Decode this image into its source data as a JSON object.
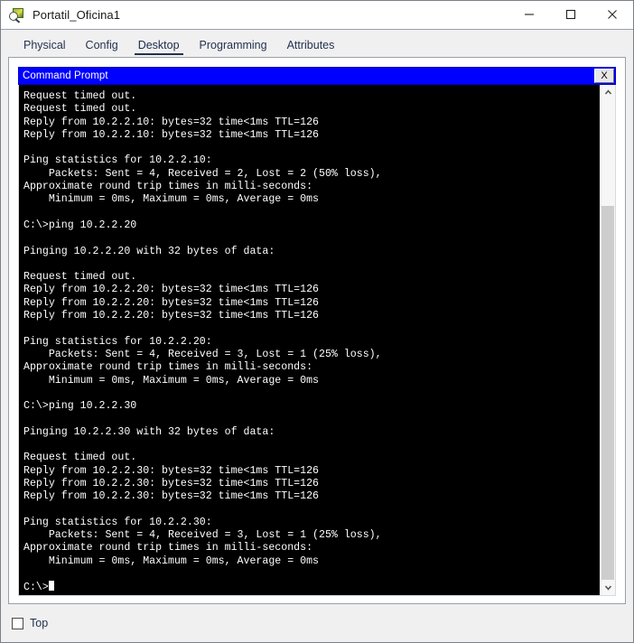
{
  "window": {
    "title": "Portatil_Oficina1",
    "icon": "packet-tracer-icon",
    "controls": {
      "minimize": "—",
      "maximize": "☐",
      "close": "✕"
    }
  },
  "tabs": [
    {
      "label": "Physical",
      "active": false
    },
    {
      "label": "Config",
      "active": false
    },
    {
      "label": "Desktop",
      "active": true
    },
    {
      "label": "Programming",
      "active": false
    },
    {
      "label": "Attributes",
      "active": false
    }
  ],
  "command_prompt": {
    "title": "Command Prompt",
    "close_label": "X",
    "colors": {
      "titlebar": "#0000ff",
      "background": "#000000",
      "text": "#ffffff"
    },
    "lines": [
      "Request timed out.",
      "Request timed out.",
      "Reply from 10.2.2.10: bytes=32 time<1ms TTL=126",
      "Reply from 10.2.2.10: bytes=32 time<1ms TTL=126",
      "",
      "Ping statistics for 10.2.2.10:",
      "    Packets: Sent = 4, Received = 2, Lost = 2 (50% loss),",
      "Approximate round trip times in milli-seconds:",
      "    Minimum = 0ms, Maximum = 0ms, Average = 0ms",
      "",
      "C:\\>ping 10.2.2.20",
      "",
      "Pinging 10.2.2.20 with 32 bytes of data:",
      "",
      "Request timed out.",
      "Reply from 10.2.2.20: bytes=32 time<1ms TTL=126",
      "Reply from 10.2.2.20: bytes=32 time<1ms TTL=126",
      "Reply from 10.2.2.20: bytes=32 time<1ms TTL=126",
      "",
      "Ping statistics for 10.2.2.20:",
      "    Packets: Sent = 4, Received = 3, Lost = 1 (25% loss),",
      "Approximate round trip times in milli-seconds:",
      "    Minimum = 0ms, Maximum = 0ms, Average = 0ms",
      "",
      "C:\\>ping 10.2.2.30",
      "",
      "Pinging 10.2.2.30 with 32 bytes of data:",
      "",
      "Request timed out.",
      "Reply from 10.2.2.30: bytes=32 time<1ms TTL=126",
      "Reply from 10.2.2.30: bytes=32 time<1ms TTL=126",
      "Reply from 10.2.2.30: bytes=32 time<1ms TTL=126",
      "",
      "Ping statistics for 10.2.2.30:",
      "    Packets: Sent = 4, Received = 3, Lost = 1 (25% loss),",
      "Approximate round trip times in milli-seconds:",
      "    Minimum = 0ms, Maximum = 0ms, Average = 0ms",
      "",
      "C:\\>"
    ],
    "scrollbar": {
      "up_icon": "chevron-up-icon",
      "down_icon": "chevron-down-icon"
    }
  },
  "bottom": {
    "top_checkbox_label": "Top",
    "top_checkbox_checked": false
  }
}
